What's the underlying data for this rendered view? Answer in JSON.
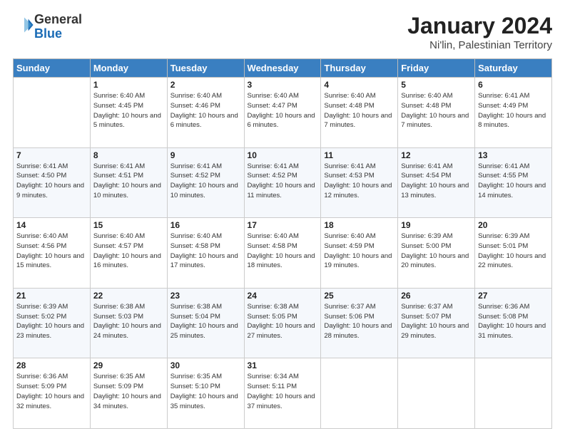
{
  "header": {
    "logo": {
      "line1": "General",
      "line2": "Blue"
    },
    "title": "January 2024",
    "subtitle": "Ni'lin, Palestinian Territory"
  },
  "days_of_week": [
    "Sunday",
    "Monday",
    "Tuesday",
    "Wednesday",
    "Thursday",
    "Friday",
    "Saturday"
  ],
  "weeks": [
    [
      {
        "day": null
      },
      {
        "day": 1,
        "sunrise": "6:40 AM",
        "sunset": "4:45 PM",
        "daylight": "10 hours and 5 minutes."
      },
      {
        "day": 2,
        "sunrise": "6:40 AM",
        "sunset": "4:46 PM",
        "daylight": "10 hours and 6 minutes."
      },
      {
        "day": 3,
        "sunrise": "6:40 AM",
        "sunset": "4:47 PM",
        "daylight": "10 hours and 6 minutes."
      },
      {
        "day": 4,
        "sunrise": "6:40 AM",
        "sunset": "4:48 PM",
        "daylight": "10 hours and 7 minutes."
      },
      {
        "day": 5,
        "sunrise": "6:40 AM",
        "sunset": "4:48 PM",
        "daylight": "10 hours and 7 minutes."
      },
      {
        "day": 6,
        "sunrise": "6:41 AM",
        "sunset": "4:49 PM",
        "daylight": "10 hours and 8 minutes."
      }
    ],
    [
      {
        "day": 7,
        "sunrise": "6:41 AM",
        "sunset": "4:50 PM",
        "daylight": "10 hours and 9 minutes."
      },
      {
        "day": 8,
        "sunrise": "6:41 AM",
        "sunset": "4:51 PM",
        "daylight": "10 hours and 10 minutes."
      },
      {
        "day": 9,
        "sunrise": "6:41 AM",
        "sunset": "4:52 PM",
        "daylight": "10 hours and 10 minutes."
      },
      {
        "day": 10,
        "sunrise": "6:41 AM",
        "sunset": "4:52 PM",
        "daylight": "10 hours and 11 minutes."
      },
      {
        "day": 11,
        "sunrise": "6:41 AM",
        "sunset": "4:53 PM",
        "daylight": "10 hours and 12 minutes."
      },
      {
        "day": 12,
        "sunrise": "6:41 AM",
        "sunset": "4:54 PM",
        "daylight": "10 hours and 13 minutes."
      },
      {
        "day": 13,
        "sunrise": "6:41 AM",
        "sunset": "4:55 PM",
        "daylight": "10 hours and 14 minutes."
      }
    ],
    [
      {
        "day": 14,
        "sunrise": "6:40 AM",
        "sunset": "4:56 PM",
        "daylight": "10 hours and 15 minutes."
      },
      {
        "day": 15,
        "sunrise": "6:40 AM",
        "sunset": "4:57 PM",
        "daylight": "10 hours and 16 minutes."
      },
      {
        "day": 16,
        "sunrise": "6:40 AM",
        "sunset": "4:58 PM",
        "daylight": "10 hours and 17 minutes."
      },
      {
        "day": 17,
        "sunrise": "6:40 AM",
        "sunset": "4:58 PM",
        "daylight": "10 hours and 18 minutes."
      },
      {
        "day": 18,
        "sunrise": "6:40 AM",
        "sunset": "4:59 PM",
        "daylight": "10 hours and 19 minutes."
      },
      {
        "day": 19,
        "sunrise": "6:39 AM",
        "sunset": "5:00 PM",
        "daylight": "10 hours and 20 minutes."
      },
      {
        "day": 20,
        "sunrise": "6:39 AM",
        "sunset": "5:01 PM",
        "daylight": "10 hours and 22 minutes."
      }
    ],
    [
      {
        "day": 21,
        "sunrise": "6:39 AM",
        "sunset": "5:02 PM",
        "daylight": "10 hours and 23 minutes."
      },
      {
        "day": 22,
        "sunrise": "6:38 AM",
        "sunset": "5:03 PM",
        "daylight": "10 hours and 24 minutes."
      },
      {
        "day": 23,
        "sunrise": "6:38 AM",
        "sunset": "5:04 PM",
        "daylight": "10 hours and 25 minutes."
      },
      {
        "day": 24,
        "sunrise": "6:38 AM",
        "sunset": "5:05 PM",
        "daylight": "10 hours and 27 minutes."
      },
      {
        "day": 25,
        "sunrise": "6:37 AM",
        "sunset": "5:06 PM",
        "daylight": "10 hours and 28 minutes."
      },
      {
        "day": 26,
        "sunrise": "6:37 AM",
        "sunset": "5:07 PM",
        "daylight": "10 hours and 29 minutes."
      },
      {
        "day": 27,
        "sunrise": "6:36 AM",
        "sunset": "5:08 PM",
        "daylight": "10 hours and 31 minutes."
      }
    ],
    [
      {
        "day": 28,
        "sunrise": "6:36 AM",
        "sunset": "5:09 PM",
        "daylight": "10 hours and 32 minutes."
      },
      {
        "day": 29,
        "sunrise": "6:35 AM",
        "sunset": "5:09 PM",
        "daylight": "10 hours and 34 minutes."
      },
      {
        "day": 30,
        "sunrise": "6:35 AM",
        "sunset": "5:10 PM",
        "daylight": "10 hours and 35 minutes."
      },
      {
        "day": 31,
        "sunrise": "6:34 AM",
        "sunset": "5:11 PM",
        "daylight": "10 hours and 37 minutes."
      },
      {
        "day": null
      },
      {
        "day": null
      },
      {
        "day": null
      }
    ]
  ],
  "labels": {
    "sunrise_label": "Sunrise:",
    "sunset_label": "Sunset:",
    "daylight_label": "Daylight:"
  }
}
